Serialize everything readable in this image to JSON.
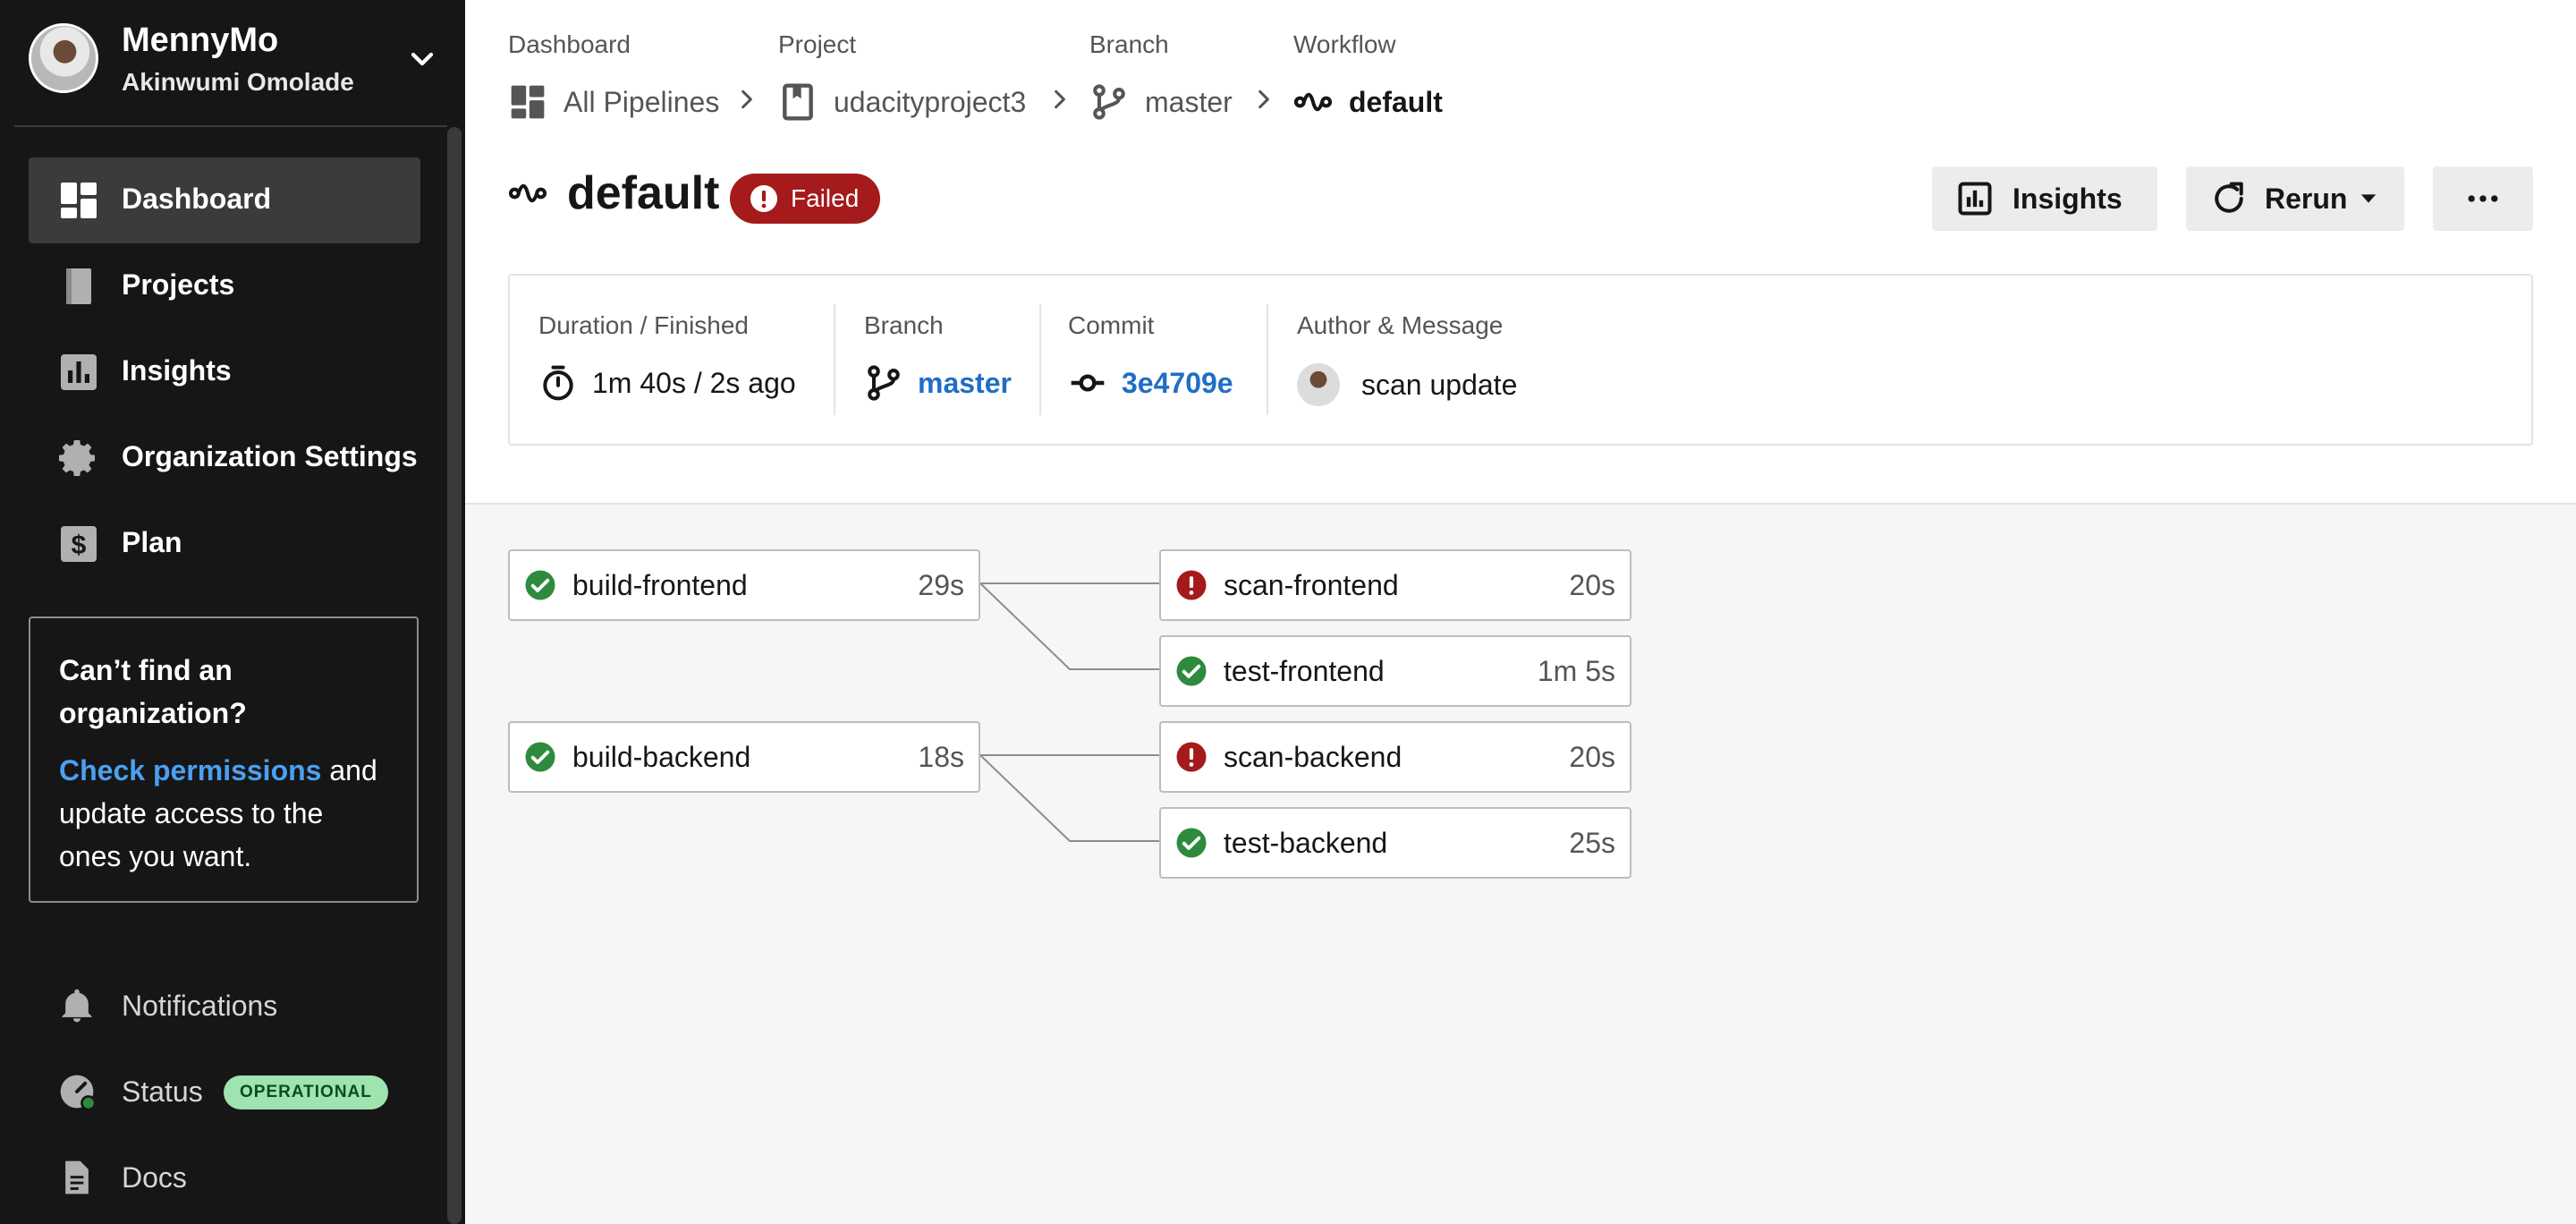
{
  "sidebar": {
    "org_name": "MennyMo",
    "user_name": "Akinwumi Omolade",
    "items": [
      {
        "label": "Dashboard",
        "icon": "dashboard-icon",
        "active": true
      },
      {
        "label": "Projects",
        "icon": "projects-icon"
      },
      {
        "label": "Insights",
        "icon": "insights-icon"
      },
      {
        "label": "Organization Settings",
        "icon": "gear-icon"
      },
      {
        "label": "Plan",
        "icon": "plan-icon"
      }
    ],
    "help": {
      "title": "Can’t find an organization?",
      "link": "Check permissions",
      "body": " and update access to the ones you want."
    },
    "bottom": {
      "notifications": "Notifications",
      "status": "Status",
      "status_badge": "OPERATIONAL",
      "docs": "Docs"
    }
  },
  "breadcrumb": {
    "dashboard": {
      "caption": "Dashboard",
      "value": "All Pipelines"
    },
    "project": {
      "caption": "Project",
      "value": "udacityproject3"
    },
    "branch": {
      "caption": "Branch",
      "value": "master"
    },
    "workflow": {
      "caption": "Workflow",
      "value": "default"
    }
  },
  "workflow": {
    "name": "default",
    "status": "Failed",
    "status_color": "#a51a1a"
  },
  "actions": {
    "insights": "Insights",
    "rerun": "Rerun"
  },
  "details": {
    "duration_caption": "Duration / Finished",
    "duration_value": "1m 40s / 2s ago",
    "branch_caption": "Branch",
    "branch_value": "master",
    "commit_caption": "Commit",
    "commit_value": "3e4709e",
    "author_caption": "Author & Message",
    "author_message": "scan update"
  },
  "jobs": {
    "build_frontend": {
      "name": "build-frontend",
      "duration": "29s",
      "status": "success"
    },
    "scan_frontend": {
      "name": "scan-frontend",
      "duration": "20s",
      "status": "failed"
    },
    "test_frontend": {
      "name": "test-frontend",
      "duration": "1m 5s",
      "status": "success"
    },
    "build_backend": {
      "name": "build-backend",
      "duration": "18s",
      "status": "success"
    },
    "scan_backend": {
      "name": "scan-backend",
      "duration": "20s",
      "status": "failed"
    },
    "test_backend": {
      "name": "test-backend",
      "duration": "25s",
      "status": "success"
    }
  },
  "colors": {
    "success": "#2e8b3d",
    "failed": "#a51a1a",
    "link": "#1f6ec7",
    "operational_badge": "#9fe3b0"
  }
}
